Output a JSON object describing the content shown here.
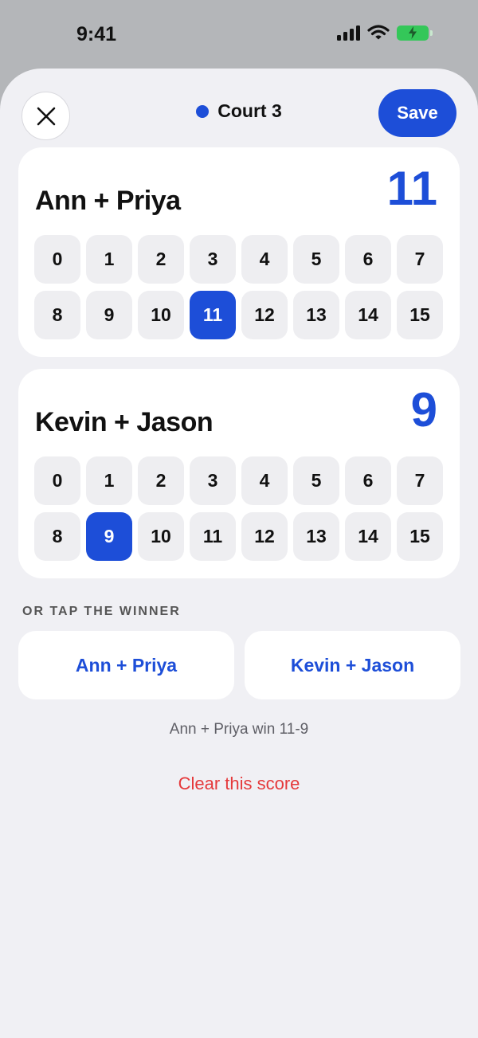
{
  "status_bar": {
    "time": "9:41"
  },
  "header": {
    "court_label": "Court 3",
    "save_label": "Save"
  },
  "teams": [
    {
      "name": "Ann + Priya",
      "score": "11",
      "selected": 11
    },
    {
      "name": "Kevin + Jason",
      "score": "9",
      "selected": 9
    }
  ],
  "score_options": [
    "0",
    "1",
    "2",
    "3",
    "4",
    "5",
    "6",
    "7",
    "8",
    "9",
    "10",
    "11",
    "12",
    "13",
    "14",
    "15"
  ],
  "winner_section": {
    "label": "OR TAP THE WINNER",
    "buttons": [
      "Ann + Priya",
      "Kevin + Jason"
    ]
  },
  "result_text": "Ann + Priya win 11-9",
  "clear_label": "Clear this score",
  "colors": {
    "accent": "#1d4ed8",
    "danger": "#e5393b",
    "battery": "#34c759",
    "sheet_bg": "#f0f0f4"
  }
}
